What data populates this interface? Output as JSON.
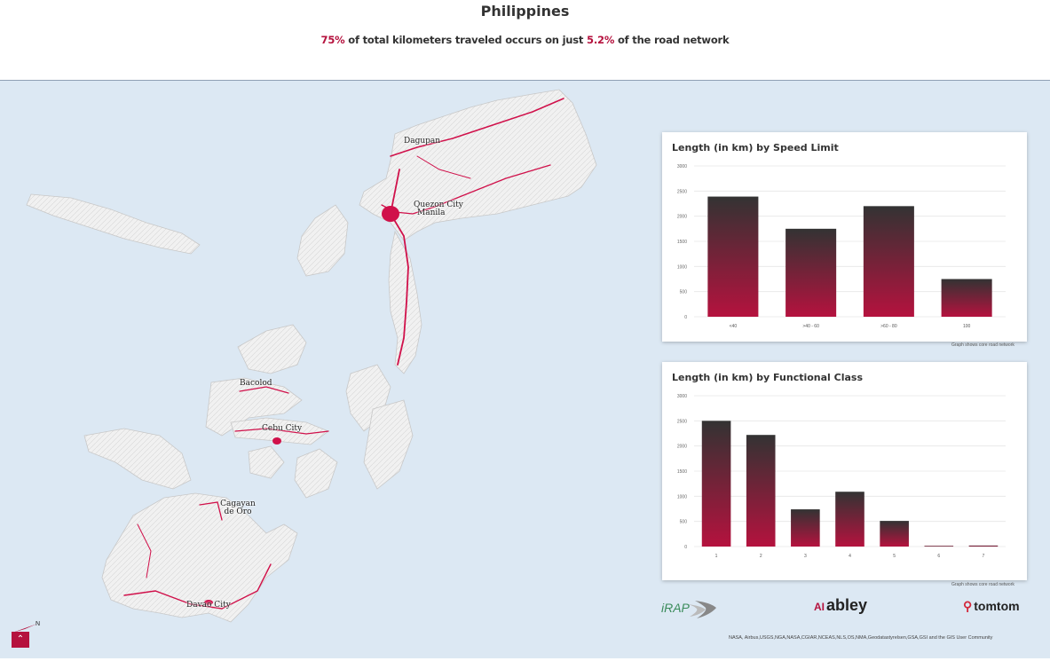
{
  "header": {
    "title": "Philippines",
    "subtitle_pct1": "75%",
    "subtitle_mid": " of total kilometers traveled occurs on just ",
    "subtitle_pct2": "5.2%",
    "subtitle_end": " of the road network"
  },
  "colors": {
    "accent": "#b5123e",
    "bar_top": "#333333",
    "bar_bottom": "#b5123e",
    "road": "#d0104a",
    "sea": "#dce8f3"
  },
  "cities": [
    {
      "name": "Dagupan"
    },
    {
      "name": "Quezon City"
    },
    {
      "name": "Manila"
    },
    {
      "name": "Bacolod"
    },
    {
      "name": "Cebu City"
    },
    {
      "name": "Cagayan de Oro"
    },
    {
      "name": "Davao City"
    }
  ],
  "chart_data": [
    {
      "type": "bar",
      "title": "Length (in km) by Speed Limit",
      "categories": [
        "<40",
        ">40 - 60",
        ">60 - 80",
        "100"
      ],
      "values": [
        2390,
        1750,
        2200,
        750
      ],
      "ylim": [
        0,
        3000
      ],
      "yticks": [
        0,
        500,
        1000,
        1500,
        2000,
        2500,
        3000
      ],
      "grid": true,
      "note": "Graph shows core road network"
    },
    {
      "type": "bar",
      "title": "Length (in km) by Functional Class",
      "categories": [
        "1",
        "2",
        "3",
        "4",
        "5",
        "6",
        "7"
      ],
      "values": [
        2500,
        2220,
        740,
        1090,
        510,
        15,
        20
      ],
      "ylim": [
        0,
        3000
      ],
      "yticks": [
        0,
        500,
        1000,
        1500,
        2000,
        2500,
        3000
      ],
      "grid": true,
      "note": "Graph shows core road network"
    }
  ],
  "logos": {
    "irap": "iRAP",
    "abley_mark": "AI",
    "abley": "abley",
    "tomtom": "tomtom"
  },
  "credits": "NASA, Airbus,USGS,NGA,NASA,CGIAR,NCEAS,NLS,OS,NMA,Geodatastyrelsen,GSA,GSI and the GIS User Community",
  "controls": {
    "home_icon": "chevron-up-icon",
    "compass_icon": "compass-icon"
  }
}
